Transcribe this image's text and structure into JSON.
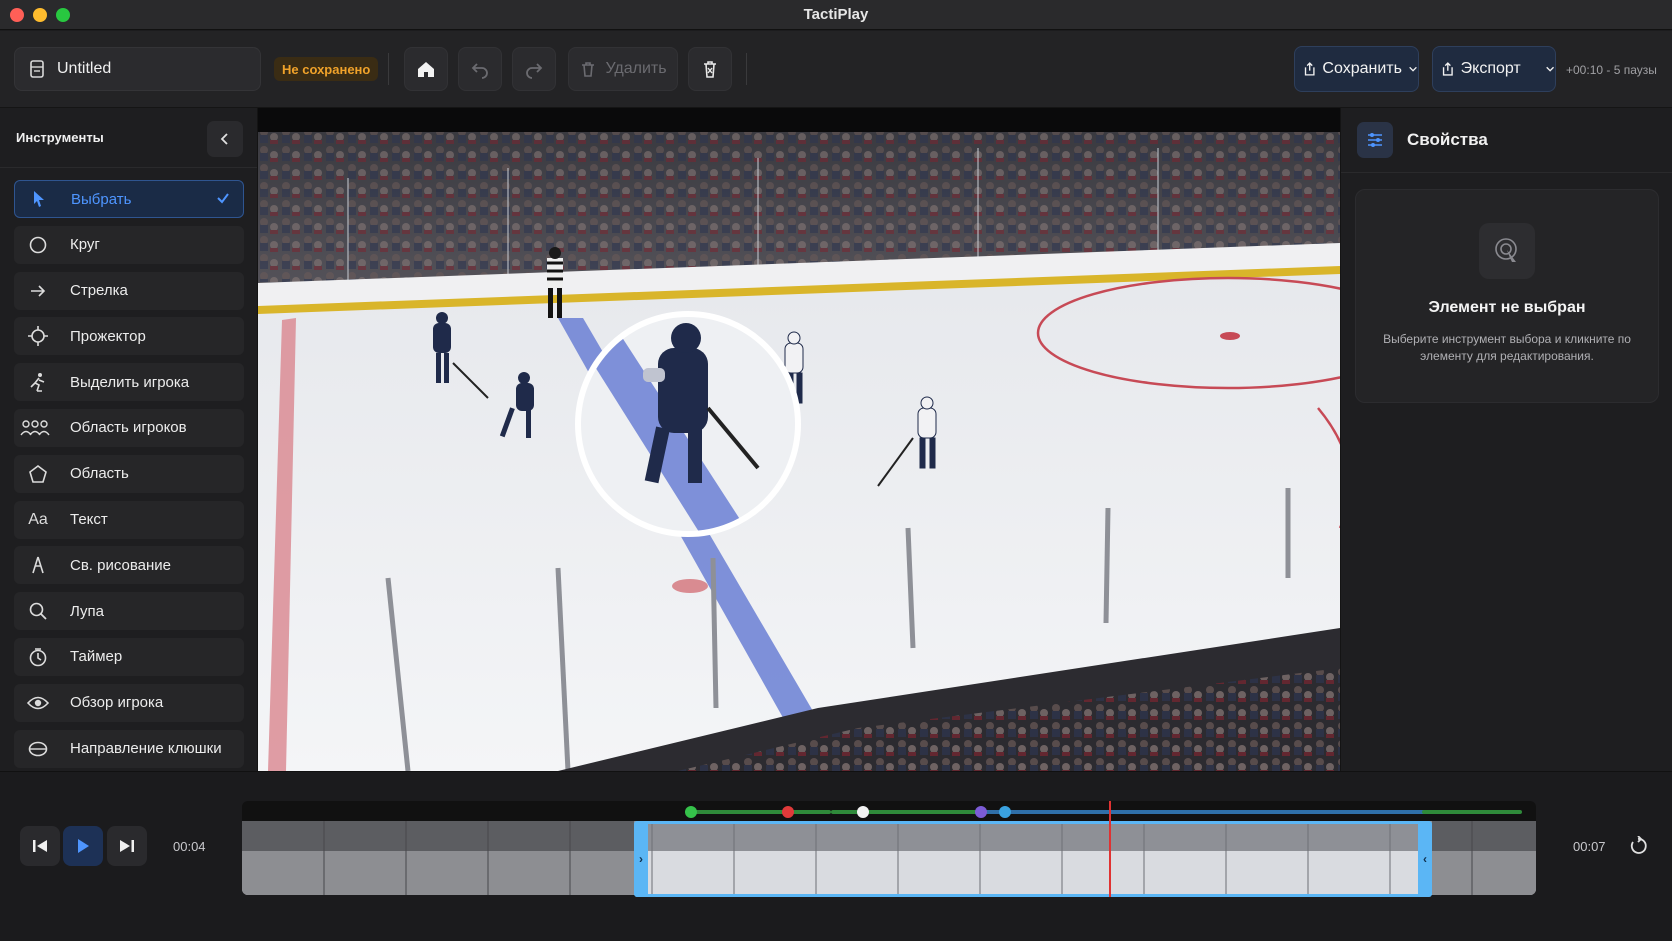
{
  "window": {
    "title": "TactiPlay"
  },
  "toolbar": {
    "doc_name": "Untitled",
    "unsaved_badge": "Не сохранено",
    "delete_label": "Удалить",
    "save_label": "Сохранить",
    "export_label": "Экспорт",
    "duration_info": "+00:10 - 5 паузы"
  },
  "sidebar": {
    "title": "Инструменты",
    "tools": [
      {
        "label": "Выбрать",
        "icon": "cursor-icon",
        "active": true
      },
      {
        "label": "Круг",
        "icon": "circle-icon"
      },
      {
        "label": "Стрелка",
        "icon": "arrow-right-icon"
      },
      {
        "label": "Прожектор",
        "icon": "spotlight-icon"
      },
      {
        "label": "Выделить игрока",
        "icon": "skater-icon"
      },
      {
        "label": "Область игроков",
        "icon": "players-group-icon"
      },
      {
        "label": "Область",
        "icon": "pentagon-icon"
      },
      {
        "label": "Текст",
        "icon": "text-icon"
      },
      {
        "label": "Св. рисование",
        "icon": "freehand-icon"
      },
      {
        "label": "Лупа",
        "icon": "magnifier-icon"
      },
      {
        "label": "Таймер",
        "icon": "timer-icon"
      },
      {
        "label": "Обзор игрока",
        "icon": "eye-icon"
      },
      {
        "label": "Направление клюшки",
        "icon": "stick-direction-icon"
      }
    ]
  },
  "properties": {
    "title": "Свойства",
    "empty_title": "Элемент не выбран",
    "empty_desc": "Выберите инструмент выбора и кликните по элементу для редактирования."
  },
  "timeline": {
    "current_time": "00:04",
    "end_time": "00:07"
  },
  "colors": {
    "accent": "#4e95ff",
    "unsaved": "#f0a22a",
    "selection": "#5bb6f5",
    "playhead": "#e03232"
  }
}
